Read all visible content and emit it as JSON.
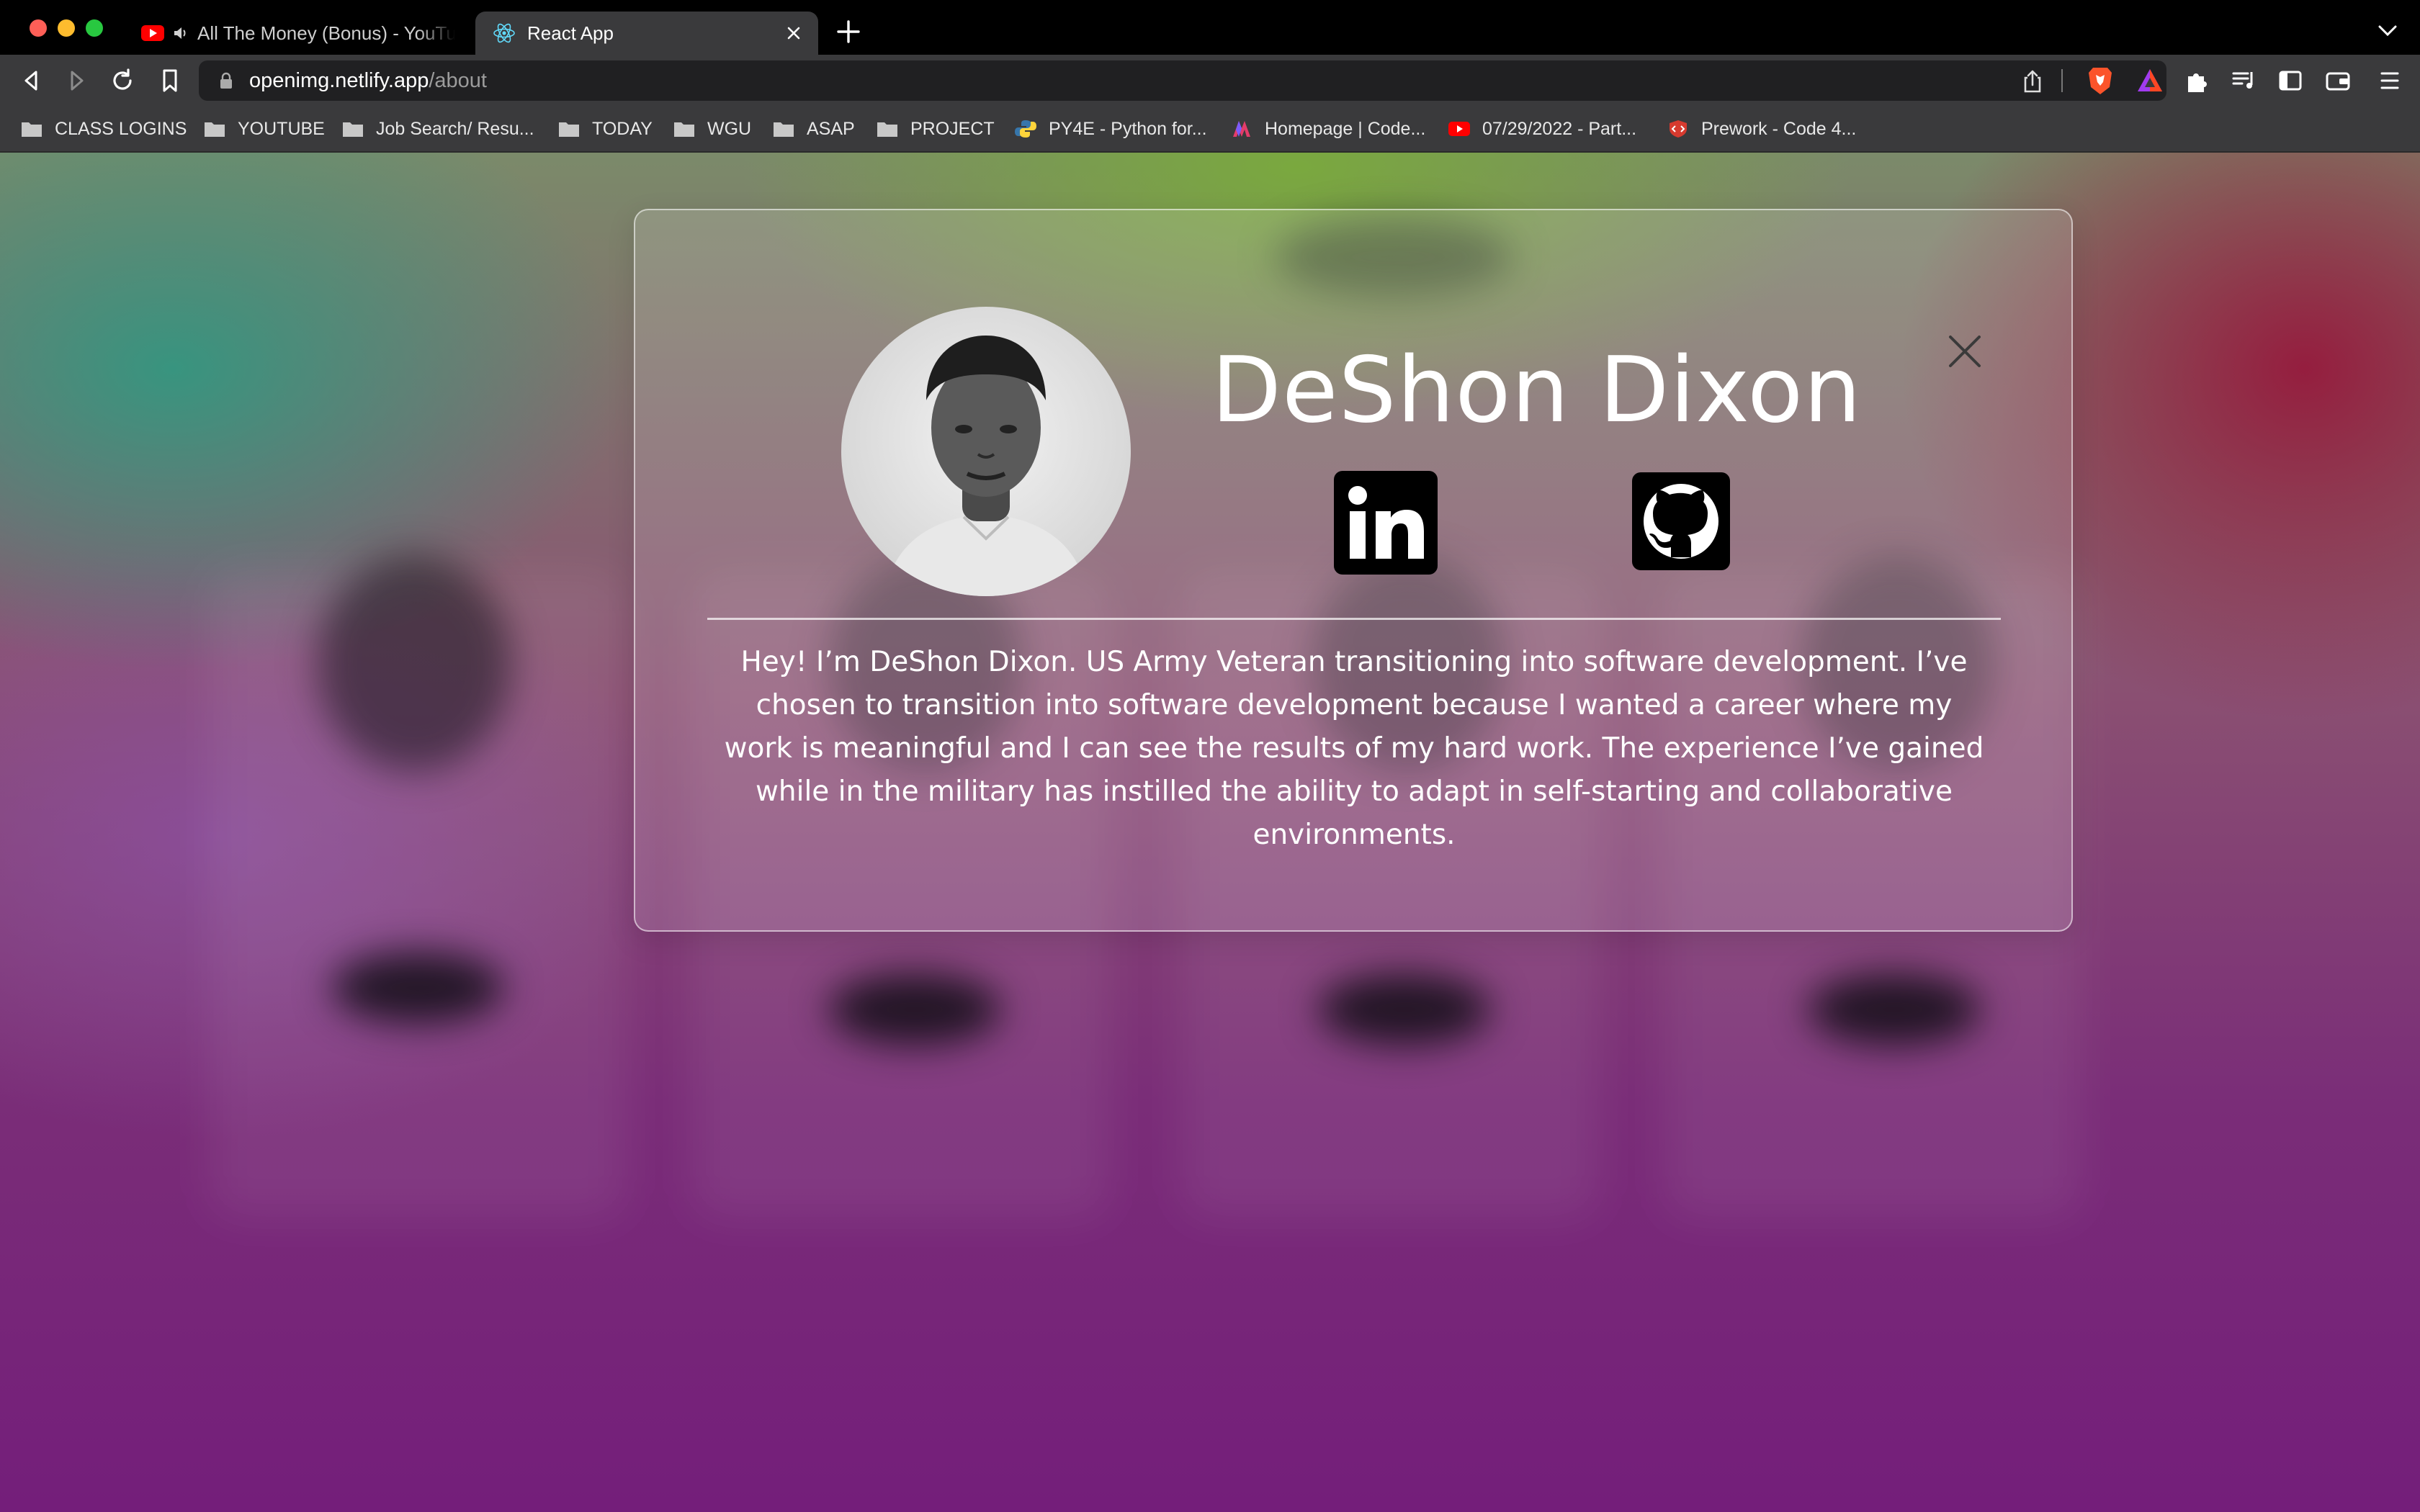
{
  "browser": {
    "tabs": [
      {
        "label": "All The Money (Bonus) - YouTube",
        "active": false,
        "favicon": "youtube-icon",
        "audio": true
      },
      {
        "label": "React App",
        "active": true,
        "favicon": "react-icon"
      }
    ],
    "url": {
      "host": "openimg.netlify.app",
      "path": "/about"
    },
    "bookmarks": [
      {
        "label": "CLASS LOGINS",
        "icon": "folder-icon"
      },
      {
        "label": "YOUTUBE",
        "icon": "folder-icon"
      },
      {
        "label": "Job Search/ Resu...",
        "icon": "folder-icon"
      },
      {
        "label": "TODAY",
        "icon": "folder-icon"
      },
      {
        "label": "WGU",
        "icon": "folder-icon"
      },
      {
        "label": "ASAP",
        "icon": "folder-icon"
      },
      {
        "label": "PROJECT",
        "icon": "folder-icon"
      },
      {
        "label": "PY4E - Python for...",
        "icon": "python-icon"
      },
      {
        "label": "Homepage | Code...",
        "icon": "codecademy-icon"
      },
      {
        "label": "07/29/2022 - Part...",
        "icon": "youtube-icon"
      },
      {
        "label": "Prework - Code 4...",
        "icon": "code-shield-icon"
      }
    ]
  },
  "modal": {
    "name": "DeShon Dixon",
    "bio": "Hey! I’m DeShon Dixon. US Army Veteran transitioning into software development. I’ve chosen to transition into software development because I wanted a career where my work is meaningful and I can see the results of my hard work. The experience I’ve gained while in the military has instilled the ability to adapt in self-starting and collaborative environments.",
    "social": [
      {
        "name": "linkedin-icon"
      },
      {
        "name": "github-icon"
      }
    ]
  },
  "colors": {
    "chrome_bg": "#000000",
    "toolbar_bg": "#3a3a3c",
    "url_bg": "#202022",
    "page_top_left": "#349680",
    "page_top_center": "#7aaa3c",
    "page_top_right": "#96193c",
    "page_bottom": "#741e7a"
  }
}
